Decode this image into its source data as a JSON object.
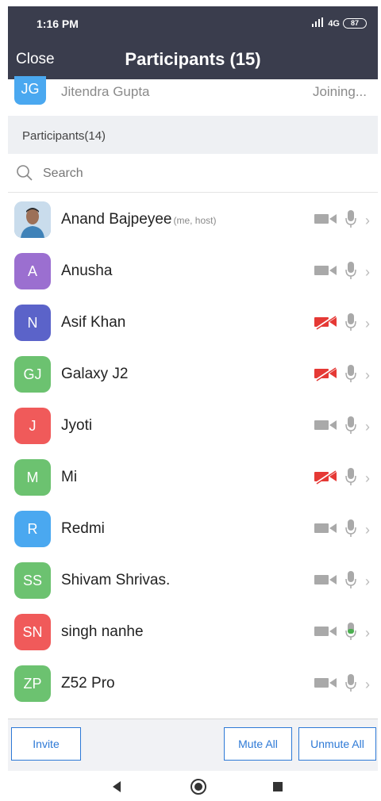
{
  "status_bar": {
    "time": "1:16 PM",
    "signal": "4G",
    "battery": "87"
  },
  "header": {
    "close_label": "Close",
    "title": "Participants (15)"
  },
  "joining": {
    "initials": "JG",
    "name": "Jitendra Gupta",
    "status": "Joining..."
  },
  "section": {
    "label": "Participants(14)"
  },
  "search": {
    "placeholder": "Search"
  },
  "participants": [
    {
      "initials": "",
      "photo": true,
      "name": "Anand Bajpeyee",
      "tag": "(me, host)",
      "video": "off",
      "mic": "on"
    },
    {
      "initials": "A",
      "name": "Anusha",
      "color": "#9b6fd0",
      "video": "off",
      "mic": "on"
    },
    {
      "initials": "N",
      "name": "Asif Khan",
      "color": "#5b63c9",
      "video": "off-red",
      "mic": "on"
    },
    {
      "initials": "GJ",
      "name": "Galaxy J2",
      "color": "#6cc270",
      "video": "off-red",
      "mic": "on"
    },
    {
      "initials": "J",
      "name": "Jyoti",
      "color": "#f05a5a",
      "video": "off",
      "mic": "on"
    },
    {
      "initials": "M",
      "name": "Mi",
      "color": "#6cc270",
      "video": "off-red",
      "mic": "on"
    },
    {
      "initials": "R",
      "name": "Redmi",
      "color": "#4aa8f0",
      "video": "off",
      "mic": "on"
    },
    {
      "initials": "SS",
      "name": "Shivam Shrivas.",
      "color": "#6cc270",
      "video": "off",
      "mic": "on"
    },
    {
      "initials": "SN",
      "name": "singh nanhe",
      "color": "#f05a5a",
      "video": "off",
      "mic": "speaking"
    },
    {
      "initials": "ZP",
      "name": "Z52 Pro",
      "color": "#6cc270",
      "video": "off",
      "mic": "on"
    }
  ],
  "bottom": {
    "invite_label": "Invite",
    "mute_all_label": "Mute All",
    "unmute_all_label": "Unmute All"
  },
  "colors": {
    "header_bg": "#3a3d4d",
    "accent": "#2d79d6",
    "muted_video": "#e53935",
    "speaking": "#4caf50"
  }
}
